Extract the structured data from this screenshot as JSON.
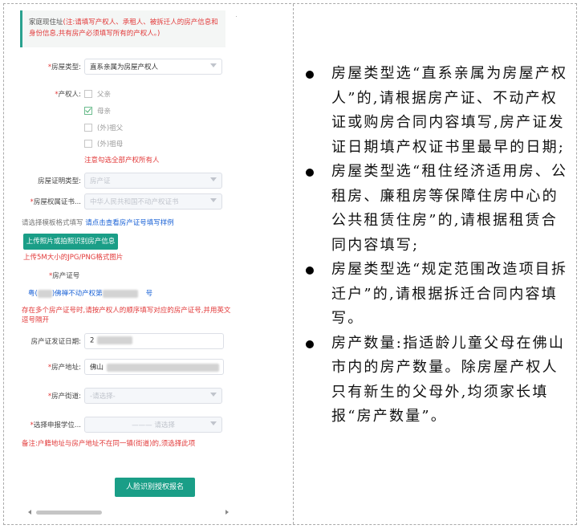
{
  "form": {
    "notice_prefix": "家庭现住址",
    "notice_red": "(注:请填写产权人、承租人、被拆迁人的房产信息和身份信息,共有房产必须填写所有的产权人。)",
    "house_type_label": "房屋类型:",
    "house_type_value": "直系亲属为房屋产权人",
    "owner_label": "产权人:",
    "owner_options": [
      {
        "label": "父亲",
        "checked": false
      },
      {
        "label": "母亲",
        "checked": true
      },
      {
        "label": "(外)祖父",
        "checked": false
      },
      {
        "label": "(外)祖母",
        "checked": false
      }
    ],
    "owner_note": "注意勾选全部产权所有人",
    "proof_type_label": "房屋证明类型:",
    "proof_type_value": "房产证",
    "cert_label": "房屋权属证书...",
    "cert_value": "中华人民共和国不动产权证书",
    "template_hint": "请选择模板格式填写",
    "template_link": "请点击查看房产证号填写样例",
    "upload_button": "上传照片或拍照识别房产信息",
    "upload_hint": "上传5M大小的JPG/PNG格式图片",
    "cert_no_label": "房产证号",
    "cert_no_prefix": "粤(",
    "cert_no_mid": ")佛禅不动产权第",
    "cert_no_suffix": "号",
    "multi_note": "存在多个房产证号时,请按产权人的顺序填写对应的房产证号,并用英文逗号隔开",
    "issue_date_label": "房产证发证日期:",
    "issue_date_value": "2",
    "address_label": "房产地址:",
    "address_value": "佛山",
    "street_label": "房产街道:",
    "street_placeholder": "-请选择-",
    "school_label": "选择申报学位...",
    "school_placeholder": "请选择",
    "remark": "备注:户籍地址与房产地址不在同一镇(街道)的,须选择此项",
    "submit_button": "人脸识别授权报名"
  },
  "notes": [
    "房屋类型选“直系亲属为房屋产权人”的,请根据房产证、不动产权证或购房合同内容填写,房产证发证日期填产权证书里最早的日期;",
    "房屋类型选“租住经济适用房、公租房、廉租房等保障住房中心的公共租赁住房”的,请根据租赁合同内容填写;",
    "房屋类型选“规定范围改造项目拆迁户”的,请根据拆迁合同内容填写。",
    "房产数量:指适龄儿童父母在佛山市内的房产数量。除房屋产权人只有新生的父母外,均须家长填报“房产数量”。"
  ],
  "colors": {
    "accent": "#1a9e87",
    "required": "#e23a3a",
    "link": "#1a62d6"
  }
}
